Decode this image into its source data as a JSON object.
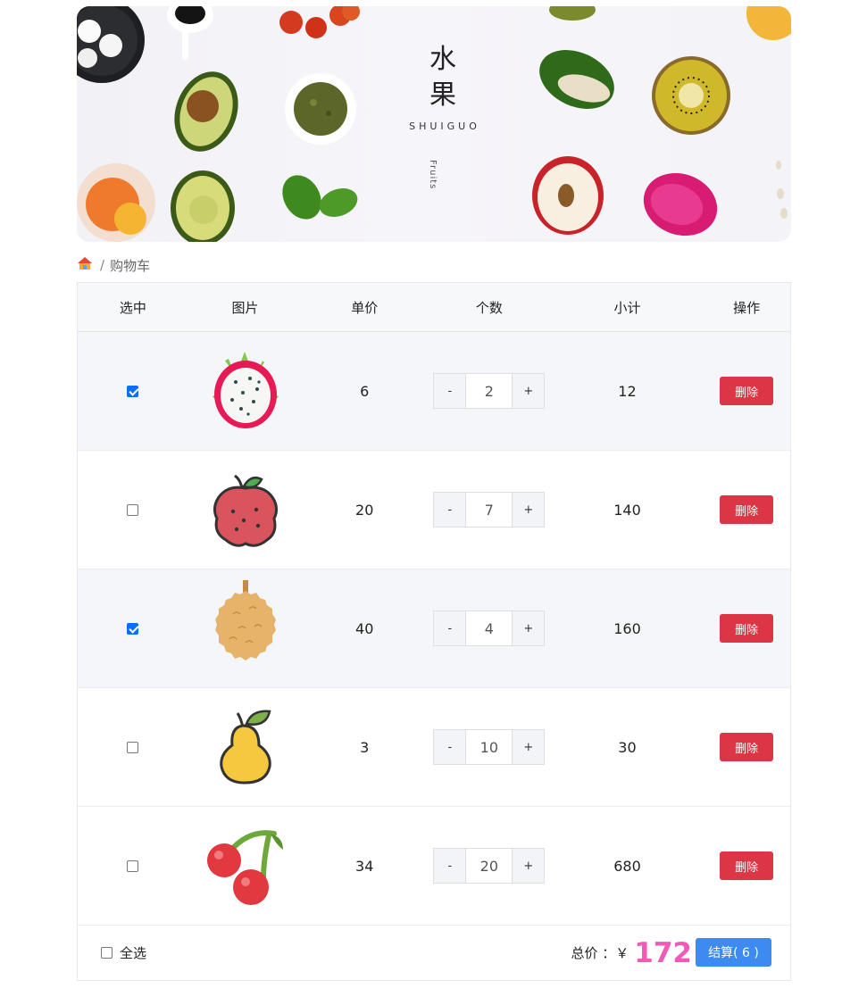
{
  "banner": {
    "title_line1": "水",
    "title_line2": "果",
    "subtitle": "SHUIGUO",
    "english": "Fruits"
  },
  "breadcrumb": {
    "home_icon": "home-icon",
    "separator": "/",
    "current": "购物车"
  },
  "table": {
    "headers": [
      "选中",
      "图片",
      "单价",
      "个数",
      "小计",
      "操作"
    ],
    "rows": [
      {
        "checked": true,
        "image": "dragon-fruit-icon",
        "price": "6",
        "count": "2",
        "subtotal": "12",
        "action": "删除"
      },
      {
        "checked": false,
        "image": "lychee-icon",
        "price": "20",
        "count": "7",
        "subtotal": "140",
        "action": "删除"
      },
      {
        "checked": true,
        "image": "durian-icon",
        "price": "40",
        "count": "4",
        "subtotal": "160",
        "action": "删除"
      },
      {
        "checked": false,
        "image": "pear-icon",
        "price": "3",
        "count": "10",
        "subtotal": "30",
        "action": "删除"
      },
      {
        "checked": false,
        "image": "cherry-icon",
        "price": "34",
        "count": "20",
        "subtotal": "680",
        "action": "删除"
      }
    ],
    "minus_label": "-",
    "plus_label": "+"
  },
  "footer": {
    "select_all_label": "全选",
    "select_all_checked": false,
    "total_label": "总价 ：￥",
    "total_value": "172",
    "checkout_label": "结算( 6 )"
  },
  "colors": {
    "delete": "#dc3545",
    "checkout": "#3d8af0",
    "total": "#f25ab8",
    "checkbox": "#0b6ff3"
  }
}
